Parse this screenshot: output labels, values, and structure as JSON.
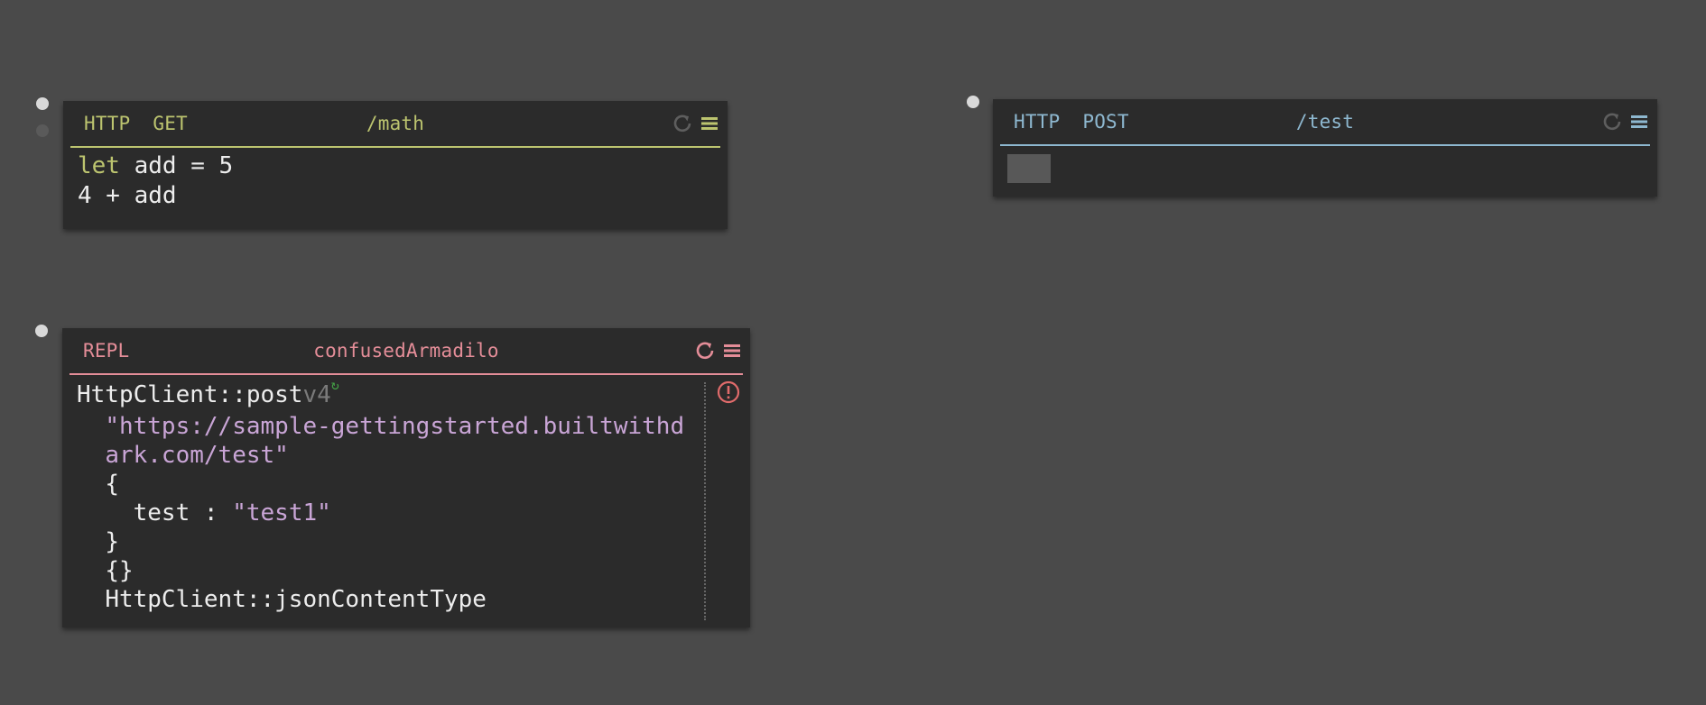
{
  "canvas": {
    "background": "#4a4a4a"
  },
  "handlers": [
    {
      "kind": "HTTP",
      "verb": "GET",
      "name": "/math",
      "color": "#bcc46f",
      "code": {
        "kw": "let",
        "line1_rest": " add = 5",
        "line2": "4 + add"
      }
    },
    {
      "kind": "HTTP",
      "verb": "POST",
      "name": "/test",
      "color": "#8eb8d0"
    },
    {
      "kind": "REPL",
      "name": "confusedArmadilo",
      "color": "#e48d98",
      "code": {
        "fn": "HttpClient::post",
        "version": "v4",
        "version_icon": "refresh-icon",
        "url_line1": "\"https://sample-gettingstarted.builtwithd",
        "url_line2": "ark.com/test\"",
        "open_brace": "{",
        "field": "test : ",
        "field_value": "\"test1\"",
        "close_brace": "}",
        "empty_record": "{}",
        "content_type": "HttpClient::jsonContentType"
      },
      "status_icon": "error-icon"
    }
  ]
}
